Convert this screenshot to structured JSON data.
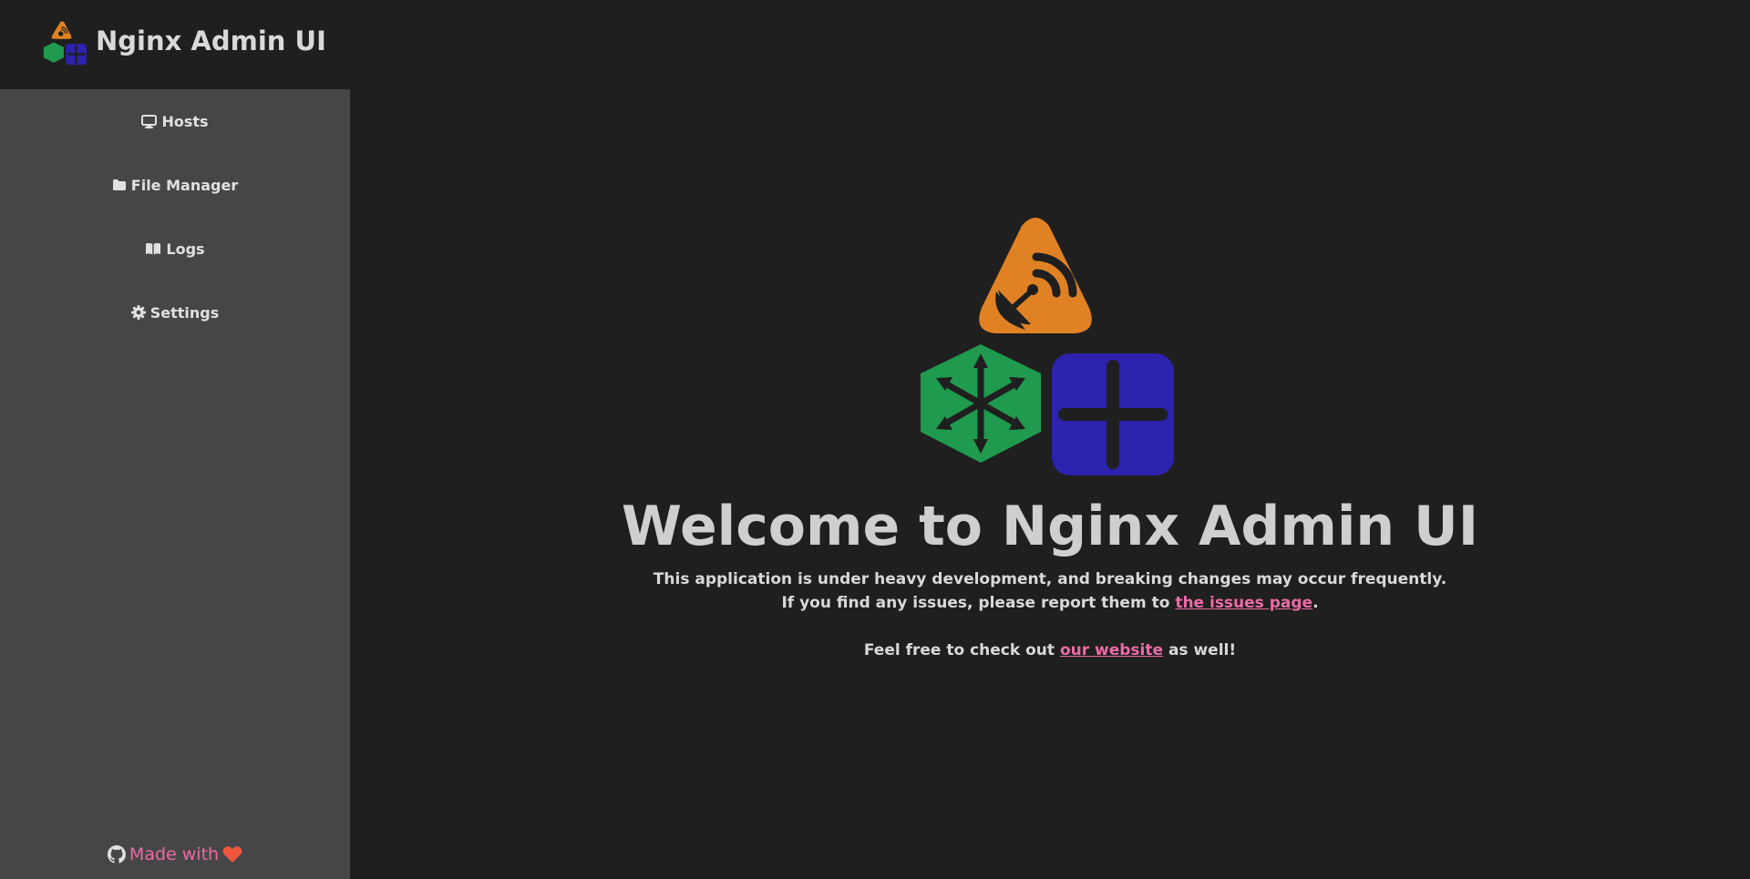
{
  "app": {
    "title": "Nginx Admin UI"
  },
  "sidebar": {
    "items": [
      {
        "label": "Hosts",
        "icon": "monitor-icon"
      },
      {
        "label": "File Manager",
        "icon": "folder-icon"
      },
      {
        "label": "Logs",
        "icon": "book-icon"
      },
      {
        "label": "Settings",
        "icon": "gear-icon"
      }
    ],
    "footer": {
      "text": "Made with",
      "github_icon": "github-icon",
      "heart_icon": "heart-icon"
    }
  },
  "main": {
    "welcome_title": "Welcome to Nginx Admin UI",
    "line1": "This application is under heavy development, and breaking changes may occur frequently.",
    "line2_prefix": "If you find any issues, please report them to ",
    "line2_link": "the issues page",
    "line2_suffix": ".",
    "line3_prefix": "Feel free to check out ",
    "line3_link": "our website",
    "line3_suffix": " as well!"
  },
  "colors": {
    "background": "#1f1f1f",
    "sidebar": "#464646",
    "accent_link": "#ec6aa6",
    "logo_orange": "#e08223",
    "logo_green": "#1f9a4e",
    "logo_blue": "#2c22ad",
    "heart": "#f0553e"
  }
}
